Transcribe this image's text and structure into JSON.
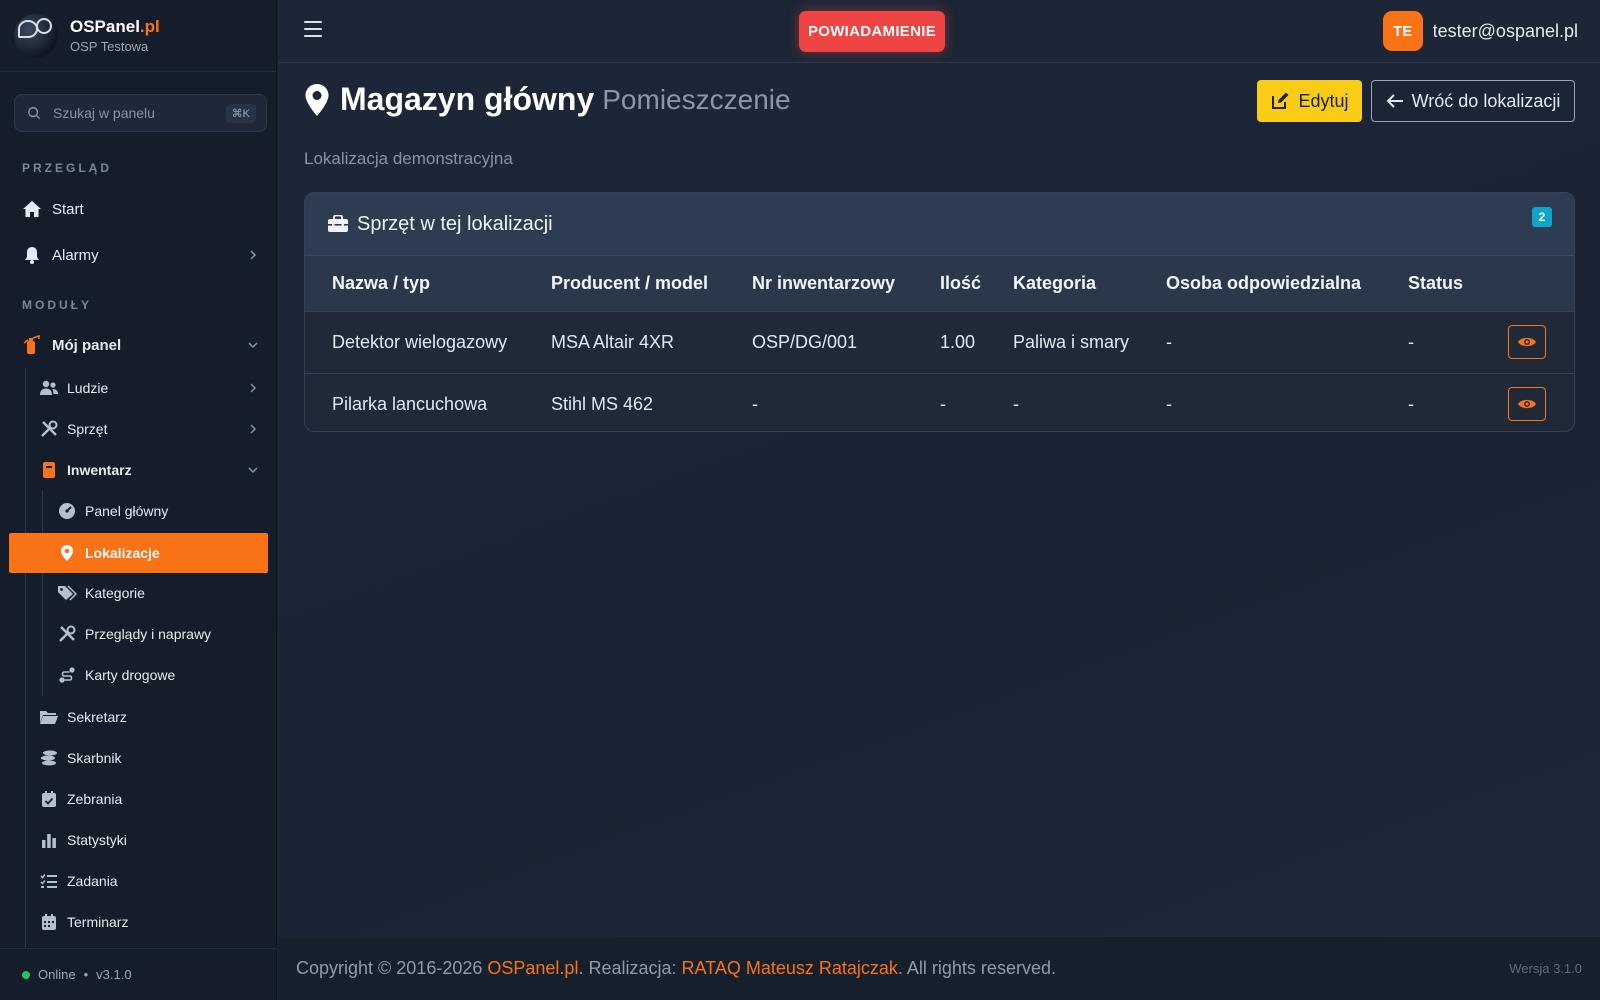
{
  "brand": {
    "name": "OSPanel",
    "tld": ".pl",
    "subtitle": "OSP Testowa"
  },
  "search": {
    "placeholder": "Szukaj w panelu",
    "shortcut": "⌘K"
  },
  "sidebar": {
    "section_overview": "PRZEGLĄD",
    "section_modules": "MODUŁY",
    "start": "Start",
    "alarms": "Alarmy",
    "my_panel": "Mój panel",
    "people": "Ludzie",
    "equipment": "Sprzęt",
    "inventory": "Inwentarz",
    "inv_dashboard": "Panel główny",
    "inv_locations": "Lokalizacje",
    "inv_categories": "Kategorie",
    "inv_inspections": "Przeglądy i naprawy",
    "inv_roadcards": "Karty drogowe",
    "secretary": "Sekretarz",
    "treasurer": "Skarbnik",
    "meetings": "Zebrania",
    "stats": "Statystyki",
    "tasks": "Zadania",
    "calendar": "Terminarz",
    "status": "Online",
    "version": "v3.1.0"
  },
  "topbar": {
    "notification": "POWIADAMIENIE",
    "avatar_initials": "TE",
    "user_email": "tester@ospanel.pl"
  },
  "page": {
    "title": "Magazyn główny",
    "subtitle": "Pomieszczenie",
    "edit_label": "Edytuj",
    "back_label": "Wróć do lokalizacji",
    "description": "Lokalizacja demonstracyjna"
  },
  "card": {
    "title": "Sprzęt w tej lokalizacji",
    "count": "2",
    "columns": [
      "Nazwa / typ",
      "Producent / model",
      "Nr inwentarzowy",
      "Ilość",
      "Kategoria",
      "Osoba odpowiedzialna",
      "Status"
    ],
    "rows": [
      [
        "Detektor wielogazowy",
        "MSA Altair 4XR",
        "OSP/DG/001",
        "1.00",
        "Paliwa i smary",
        "-",
        "-"
      ],
      [
        "Pilarka lancuchowa",
        "Stihl MS 462",
        "-",
        "-",
        "-",
        "-",
        "-"
      ]
    ]
  },
  "footer": {
    "prefix": "Copyright © 2016-2026 ",
    "brand_link": "OSPanel.pl",
    "middle": ". Realizacja: ",
    "author_link": "RATAQ Mateusz Ratajczak",
    "suffix": ". All rights reserved.",
    "version": "Wersja 3.1.0"
  },
  "colors": {
    "accent": "#f97316",
    "danger": "#ef4444",
    "warning": "#facc15",
    "info": "#0ea5c6",
    "online": "#22c55e"
  },
  "icons": {
    "start": "home-icon",
    "alarms": "bell-icon",
    "my_panel": "fire-extinguisher-icon",
    "people": "users-icon",
    "equipment": "tools-icon",
    "inventory": "book-icon",
    "inv_dashboard": "gauge-icon",
    "inv_locations": "map-pin-icon",
    "inv_categories": "tags-icon",
    "inv_inspections": "wrench-icon",
    "inv_roadcards": "route-icon",
    "secretary": "folder-icon",
    "treasurer": "coins-icon",
    "meetings": "calendar-check-icon",
    "stats": "bar-chart-icon",
    "tasks": "list-check-icon",
    "calendar": "calendar-icon"
  }
}
